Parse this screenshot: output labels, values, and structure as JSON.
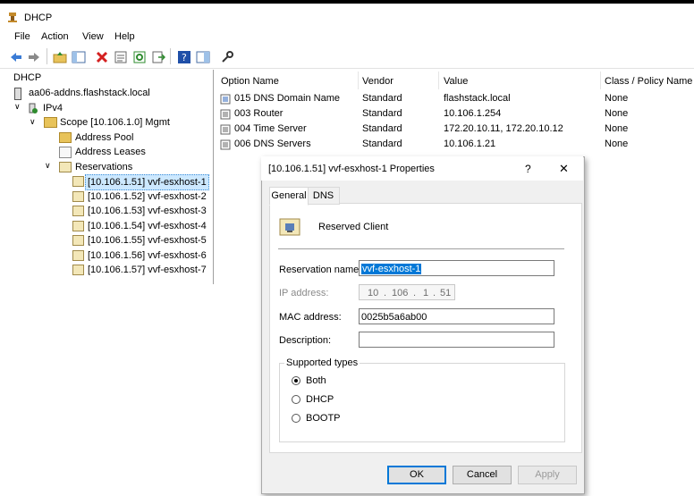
{
  "window": {
    "title": "DHCP"
  },
  "menu": [
    "File",
    "Action",
    "View",
    "Help"
  ],
  "tree": {
    "root": "DHCP",
    "server": "aa06-addns.flashstack.local",
    "ipv4": "IPv4",
    "scope": "Scope [10.106.1.0] Mgmt",
    "address_pool": "Address Pool",
    "address_leases": "Address Leases",
    "reservations": "Reservations",
    "reservation_items": [
      "[10.106.1.51] vvf-esxhost-1",
      "[10.106.1.52] vvf-esxhost-2",
      "[10.106.1.53] vvf-esxhost-3",
      "[10.106.1.54] vvf-esxhost-4",
      "[10.106.1.55] vvf-esxhost-5",
      "[10.106.1.56] vvf-esxhost-6",
      "[10.106.1.57] vvf-esxhost-7"
    ]
  },
  "list": {
    "columns": [
      "Option Name",
      "Vendor",
      "Value",
      "Class / Policy Name"
    ],
    "rows": [
      [
        "015 DNS Domain Name",
        "Standard",
        "flashstack.local",
        "None"
      ],
      [
        "003 Router",
        "Standard",
        "10.106.1.254",
        "None"
      ],
      [
        "004 Time Server",
        "Standard",
        "172.20.10.11, 172.20.10.12",
        "None"
      ],
      [
        "006 DNS Servers",
        "Standard",
        "10.106.1.21",
        "None"
      ]
    ]
  },
  "dialog": {
    "title": "[10.106.1.51] vvf-esxhost-1 Properties",
    "help": "?",
    "close": "✕",
    "tabs": [
      "General",
      "DNS"
    ],
    "header_label": "Reserved Client",
    "reservation_name_label": "Reservation name:",
    "reservation_name_value": "vvf-esxhost-1",
    "ip_label": "IP address:",
    "ip_octets": [
      "10",
      "106",
      "1",
      "51"
    ],
    "mac_label": "MAC address:",
    "mac_value": "0025b5a6ab00",
    "description_label": "Description:",
    "description_value": "",
    "supported_types_label": "Supported types",
    "types": [
      "Both",
      "DHCP",
      "BOOTP"
    ],
    "selected_type": "Both",
    "ok": "OK",
    "cancel": "Cancel",
    "apply": "Apply"
  }
}
